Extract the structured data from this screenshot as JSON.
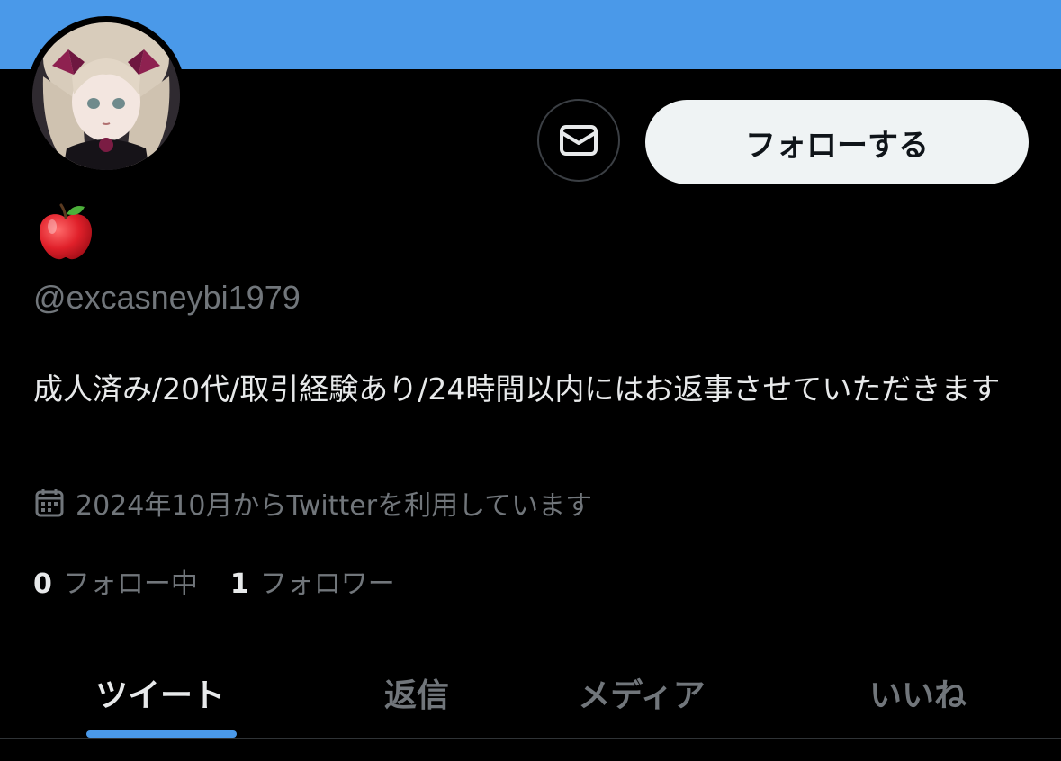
{
  "colors": {
    "banner": "#4a99e9",
    "accent": "#4a99e9",
    "text_primary": "#e7e9ea",
    "text_secondary": "#71767b",
    "follow_button_bg": "#eff3f4"
  },
  "profile": {
    "display_name_icon": "red-apple-emoji-icon",
    "handle": "@excasneybi1979",
    "bio": "成人済み/20代/取引経験あり/24時間以内にはお返事させていただきます",
    "joined": "2024年10月からTwitterを利用しています",
    "joined_icon": "calendar-icon"
  },
  "actions": {
    "message_icon": "envelope-icon",
    "follow_label": "フォローする"
  },
  "stats": {
    "following_count": "0",
    "following_label": "フォロー中",
    "followers_count": "1",
    "followers_label": "フォロワー"
  },
  "tabs": [
    {
      "label": "ツイート",
      "active": true
    },
    {
      "label": "返信",
      "active": false
    },
    {
      "label": "メディア",
      "active": false
    },
    {
      "label": "いいね",
      "active": false
    }
  ]
}
